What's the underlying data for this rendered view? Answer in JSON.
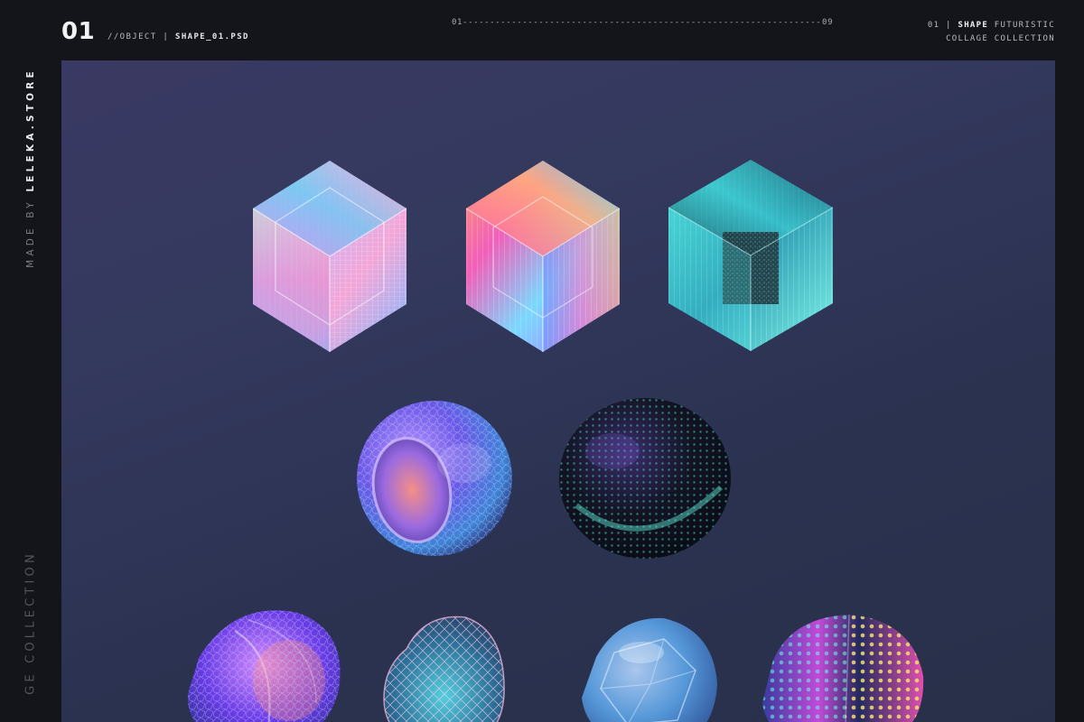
{
  "header": {
    "number": "01",
    "path_prefix": "//OBJECT | ",
    "file_name": "SHAPE_01.PSD",
    "pager_start": "01",
    "pager_dashes": "------------------------------------------------------------------------------------------------",
    "pager_end": "09",
    "right_line1_prefix": "01 | ",
    "right_line1_bold": "SHAPE",
    "right_line1_suffix": " FUTURISTIC",
    "right_line2": "COLLAGE COLLECTION"
  },
  "sidebar": {
    "made_by": "MADE BY ",
    "brand": "LELEKA.STORE",
    "collection_fragment": "GE COLLECTION"
  },
  "colors": {
    "background": "#14151b",
    "canvas_top": "#3a3963",
    "canvas_bottom": "#283049",
    "iridescent_pink": "#f4a3d9",
    "iridescent_cyan": "#6fe6f0",
    "iridescent_violet": "#8a5cf0"
  },
  "shapes": {
    "row1": [
      "hexagon-glass-pink-icon",
      "hexagon-glass-rainbow-icon",
      "hexagon-glass-teal-icon"
    ],
    "row2": [
      "ring-sphere-violet-icon",
      "dotted-sphere-dark-icon"
    ],
    "row3": [
      "twisted-sphere-violet-icon",
      "wireframe-blob-icon",
      "glass-crystal-sphere-icon",
      "dotted-blob-rainbow-icon"
    ]
  }
}
